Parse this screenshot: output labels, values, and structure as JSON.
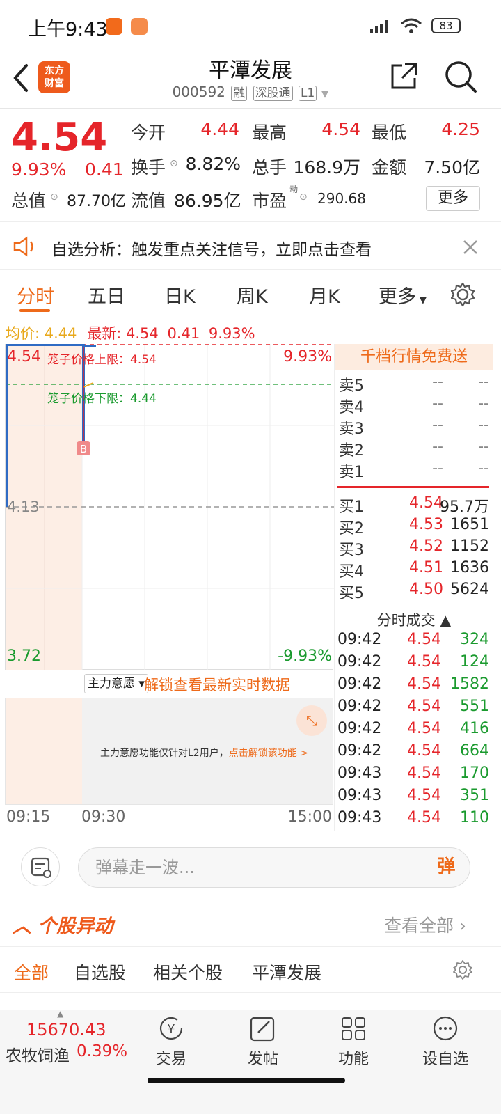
{
  "status_bar": {
    "time": "上午9:43",
    "battery": "83"
  },
  "header": {
    "name": "平潭发展",
    "code": "000592",
    "tags": [
      "融",
      "深股通",
      "L1"
    ],
    "logo": [
      "东方",
      "财富"
    ]
  },
  "quote": {
    "price": "4.54",
    "pct": "9.93%",
    "change": "0.41",
    "open_label": "今开",
    "open": "4.44",
    "high_label": "最高",
    "high": "4.54",
    "low_label": "最低",
    "low": "4.25",
    "turnover_label": "换手",
    "turnover": "8.82%",
    "volume_label": "总手",
    "volume": "168.9万",
    "amount_label": "金额",
    "amount": "7.50亿",
    "mcap_label": "总值",
    "mcap": "87.70亿",
    "float_label": "流值",
    "float_mcap": "86.95亿",
    "pe_label": "市盈",
    "pe_sup": "动",
    "pe": "290.68",
    "more": "更多"
  },
  "notice": {
    "text": "自选分析：触发重点关注信号，立即点击查看"
  },
  "tabs": [
    "分时",
    "五日",
    "日K",
    "周K",
    "月K",
    "更多"
  ],
  "legend": {
    "avg_label": "均价:",
    "avg": "4.44",
    "latest_label": "最新:",
    "latest": "4.54",
    "change": "0.41",
    "pct": "9.93%"
  },
  "chart": {
    "top_price": "4.54",
    "top_pct": "9.93%",
    "mid_price": "4.13",
    "bottom_price": "3.72",
    "bottom_pct": "-9.93%",
    "upper_limit_label": "笼子价格上限：4.54",
    "lower_limit_label": "笼子价格下限：4.44",
    "marker": "B"
  },
  "orderbook": {
    "banner": "千档行情免费送",
    "asks": [
      {
        "label": "卖5",
        "price": "--",
        "vol": "--"
      },
      {
        "label": "卖4",
        "price": "--",
        "vol": "--"
      },
      {
        "label": "卖3",
        "price": "--",
        "vol": "--"
      },
      {
        "label": "卖2",
        "price": "--",
        "vol": "--"
      },
      {
        "label": "卖1",
        "price": "--",
        "vol": "--"
      }
    ],
    "bids": [
      {
        "label": "买1",
        "price": "4.54",
        "vol": "95.7万"
      },
      {
        "label": "买2",
        "price": "4.53",
        "vol": "1651"
      },
      {
        "label": "买3",
        "price": "4.52",
        "vol": "1152"
      },
      {
        "label": "买4",
        "price": "4.51",
        "vol": "1636"
      },
      {
        "label": "买5",
        "price": "4.50",
        "vol": "5624"
      }
    ],
    "ticks_title": "分时成交 ▲",
    "ticks": [
      {
        "t": "09:42",
        "p": "4.54",
        "v": "324"
      },
      {
        "t": "09:42",
        "p": "4.54",
        "v": "124"
      },
      {
        "t": "09:42",
        "p": "4.54",
        "v": "1582"
      },
      {
        "t": "09:42",
        "p": "4.54",
        "v": "551"
      },
      {
        "t": "09:42",
        "p": "4.54",
        "v": "416"
      },
      {
        "t": "09:42",
        "p": "4.54",
        "v": "664"
      },
      {
        "t": "09:43",
        "p": "4.54",
        "v": "170"
      },
      {
        "t": "09:43",
        "p": "4.54",
        "v": "351"
      },
      {
        "t": "09:43",
        "p": "4.54",
        "v": "110"
      }
    ]
  },
  "main_force": {
    "select": "主力意愿 ▾",
    "unlock": "解锁查看最新实时数据",
    "text": "主力意愿功能仅针对L2用户，",
    "link": "点击解锁该功能 >"
  },
  "time_axis": [
    "09:15",
    "09:30",
    "15:00"
  ],
  "comment": {
    "placeholder": "弹幕走一波...",
    "send": "弹"
  },
  "movers": {
    "title": "个股异动",
    "all": "查看全部"
  },
  "sub_tabs": [
    "全部",
    "自选股",
    "相关个股",
    "平潭发展"
  ],
  "bottom_nav": {
    "index_value": "15670.43",
    "index_name": "农牧饲渔",
    "index_pct": "0.39%",
    "items": [
      "交易",
      "发帖",
      "功能",
      "设自选"
    ]
  }
}
